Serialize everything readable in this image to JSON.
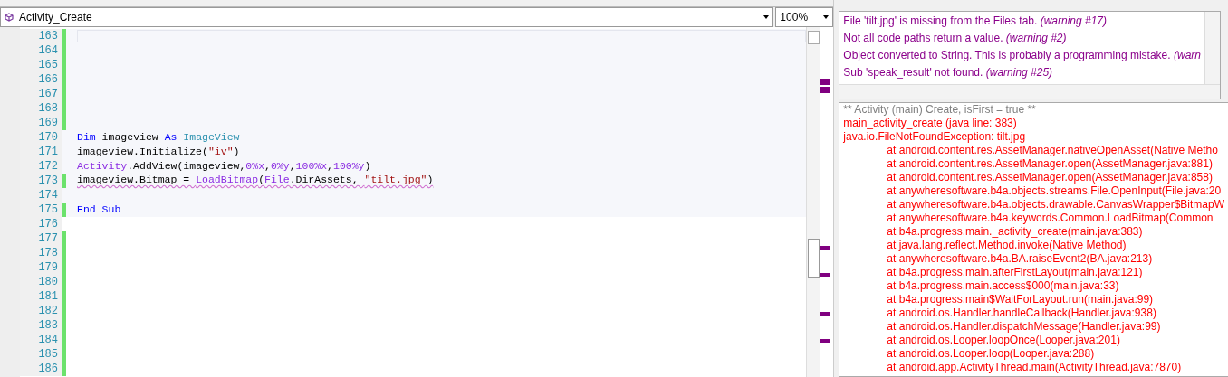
{
  "editor": {
    "module_selector": "Activity_Create",
    "zoom": "100%",
    "sections": [
      {
        "kind": "sub_body",
        "lines": [
          {
            "number": "163",
            "changed": true,
            "current": true
          },
          {
            "number": "164",
            "changed": true
          },
          {
            "number": "165",
            "changed": true
          },
          {
            "number": "166",
            "changed": true
          },
          {
            "number": "167",
            "changed": true
          },
          {
            "number": "168",
            "changed": true
          },
          {
            "number": "169",
            "changed": true
          },
          {
            "number": "170",
            "changed": false,
            "tokens": [
              {
                "kind": "keyword",
                "text": "Dim"
              },
              {
                "kind": "plain",
                "text": " imageview "
              },
              {
                "kind": "keyword",
                "text": "As"
              },
              {
                "kind": "type",
                "text": " ImageView"
              }
            ]
          },
          {
            "number": "171",
            "changed": false,
            "tokens": [
              {
                "kind": "plain",
                "text": "imageview.Initialize("
              },
              {
                "kind": "string",
                "text": "\"iv\""
              },
              {
                "kind": "plain",
                "text": ")"
              }
            ]
          },
          {
            "number": "172",
            "changed": false,
            "tokens": [
              {
                "kind": "object",
                "text": "Activity"
              },
              {
                "kind": "plain",
                "text": ".AddView(imageview,"
              },
              {
                "kind": "object",
                "text": "0%x"
              },
              {
                "kind": "plain",
                "text": ","
              },
              {
                "kind": "object",
                "text": "0%y"
              },
              {
                "kind": "plain",
                "text": ","
              },
              {
                "kind": "object",
                "text": "100%x"
              },
              {
                "kind": "plain",
                "text": ","
              },
              {
                "kind": "object",
                "text": "100%y"
              },
              {
                "kind": "plain",
                "text": ")"
              }
            ]
          },
          {
            "number": "173",
            "changed": true,
            "warning": true,
            "tokens": [
              {
                "kind": "plain",
                "text": "imageview.Bitmap = "
              },
              {
                "kind": "object",
                "text": "LoadBitmap"
              },
              {
                "kind": "plain",
                "text": "("
              },
              {
                "kind": "object",
                "text": "File"
              },
              {
                "kind": "plain",
                "text": ".DirAssets, "
              },
              {
                "kind": "string",
                "text": "\"tilt.jpg\""
              },
              {
                "kind": "plain",
                "text": ")"
              }
            ]
          },
          {
            "number": "174",
            "changed": false
          },
          {
            "number": "175",
            "changed": true,
            "tokens": [
              {
                "kind": "keyword",
                "text": "End"
              },
              {
                "kind": "keyword",
                "text": " Sub"
              }
            ]
          }
        ]
      },
      {
        "kind": "outside",
        "lines": [
          {
            "number": "176",
            "changed": false
          },
          {
            "number": "177",
            "changed": true
          },
          {
            "number": "178",
            "changed": true
          },
          {
            "number": "179",
            "changed": true
          },
          {
            "number": "180",
            "changed": true
          },
          {
            "number": "181",
            "changed": true
          },
          {
            "number": "182",
            "changed": true
          },
          {
            "number": "183",
            "changed": true
          },
          {
            "number": "184",
            "changed": true
          },
          {
            "number": "185",
            "changed": true
          },
          {
            "number": "186",
            "changed": true
          }
        ]
      }
    ]
  },
  "logs": {
    "warnings": [
      {
        "text": "File 'tilt.jpg' is missing from the Files tab. *(warning #17)*"
      },
      {
        "text": "Not all code paths return a value. *(warning #2)*"
      },
      {
        "text": "Object converted to String. This is probably a programming mistake. *(warn*"
      },
      {
        "text": "Sub 'speak_result' not found. *(warning #25)*"
      }
    ],
    "entries": [
      {
        "kind": "info",
        "text": "** Activity (main) Create, isFirst = true **"
      },
      {
        "kind": "error",
        "text": "main_activity_create (java line: 383)"
      },
      {
        "kind": "error",
        "text": "java.io.FileNotFoundException: tilt.jpg"
      },
      {
        "kind": "trace",
        "text": "at android.content.res.AssetManager.nativeOpenAsset(Native Metho"
      },
      {
        "kind": "trace",
        "text": "at android.content.res.AssetManager.open(AssetManager.java:881)"
      },
      {
        "kind": "trace",
        "text": "at android.content.res.AssetManager.open(AssetManager.java:858)"
      },
      {
        "kind": "trace",
        "text": "at anywheresoftware.b4a.objects.streams.File.OpenInput(File.java:20"
      },
      {
        "kind": "trace",
        "text": "at anywheresoftware.b4a.objects.drawable.CanvasWrapper$BitmapW"
      },
      {
        "kind": "trace",
        "text": "at anywheresoftware.b4a.keywords.Common.LoadBitmap(Common"
      },
      {
        "kind": "trace",
        "text": "at b4a.progress.main._activity_create(main.java:383)"
      },
      {
        "kind": "trace",
        "text": "at java.lang.reflect.Method.invoke(Native Method)"
      },
      {
        "kind": "trace",
        "text": "at anywheresoftware.b4a.BA.raiseEvent2(BA.java:213)"
      },
      {
        "kind": "trace",
        "text": "at b4a.progress.main.afterFirstLayout(main.java:121)"
      },
      {
        "kind": "trace",
        "text": "at b4a.progress.main.access$000(main.java:33)"
      },
      {
        "kind": "trace",
        "text": "at b4a.progress.main$WaitForLayout.run(main.java:99)"
      },
      {
        "kind": "trace",
        "text": "at android.os.Handler.handleCallback(Handler.java:938)"
      },
      {
        "kind": "trace",
        "text": "at android.os.Handler.dispatchMessage(Handler.java:99)"
      },
      {
        "kind": "trace",
        "text": "at android.os.Looper.loopOnce(Looper.java:201)"
      },
      {
        "kind": "trace",
        "text": "at android.os.Looper.loop(Looper.java:288)"
      },
      {
        "kind": "trace",
        "text": "at android.app.ActivityThread.main(ActivityThread.java:7870)"
      }
    ]
  }
}
